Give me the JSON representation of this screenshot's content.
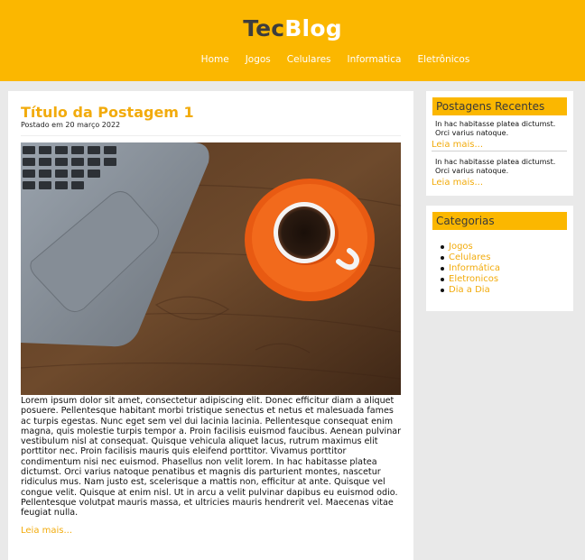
{
  "site": {
    "logo_part1": "Tec",
    "logo_part2": "Blog"
  },
  "nav": [
    "Home",
    "Jogos",
    "Celulares",
    "Informatica",
    "Eletrônicos"
  ],
  "post": {
    "title": "Título da Postagem 1",
    "date": "Postado em 20 março 2022",
    "body": "Lorem ipsum dolor sit amet, consectetur adipiscing elit. Donec efficitur diam a aliquet posuere. Pellentesque habitant morbi tristique senectus et netus et malesuada fames ac turpis egestas. Nunc eget sem vel dui lacinia lacinia. Pellentesque consequat enim magna, quis molestie turpis tempor a. Proin facilisis euismod faucibus. Aenean pulvinar vestibulum nisl at consequat. Quisque vehicula aliquet lacus, rutrum maximus elit porttitor nec. Proin facilisis mauris quis eleifend porttitor. Vivamus porttitor condimentum nisi nec euismod. Phasellus non velit lorem. In hac habitasse platea dictumst. Orci varius natoque penatibus et magnis dis parturient montes, nascetur ridiculus mus. Nam justo est, scelerisque a mattis non, efficitur at ante. Quisque vel congue velit. Quisque at enim nisl. Ut in arcu a velit pulvinar dapibus eu euismod odio. Pellentesque volutpat mauris massa, et ultricies mauris hendrerit vel. Maecenas vitae feugiat nulla.",
    "read_more": "Leia mais..."
  },
  "recent": {
    "title": "Postagens Recentes",
    "items": [
      {
        "text": "In hac habitasse platea dictumst. Orci varius natoque.",
        "read_more": "Leia mais..."
      },
      {
        "text": "In hac habitasse platea dictumst. Orci varius natoque.",
        "read_more": "Leia mais..."
      }
    ]
  },
  "categories": {
    "title": "Categorias",
    "items": [
      "Jogos",
      "Celulares",
      "Informática",
      "Eletronicos",
      "Dia a Dia"
    ]
  },
  "colors": {
    "accent": "#fbb700",
    "link": "#f2ab0c",
    "background": "#e9e9e9"
  }
}
